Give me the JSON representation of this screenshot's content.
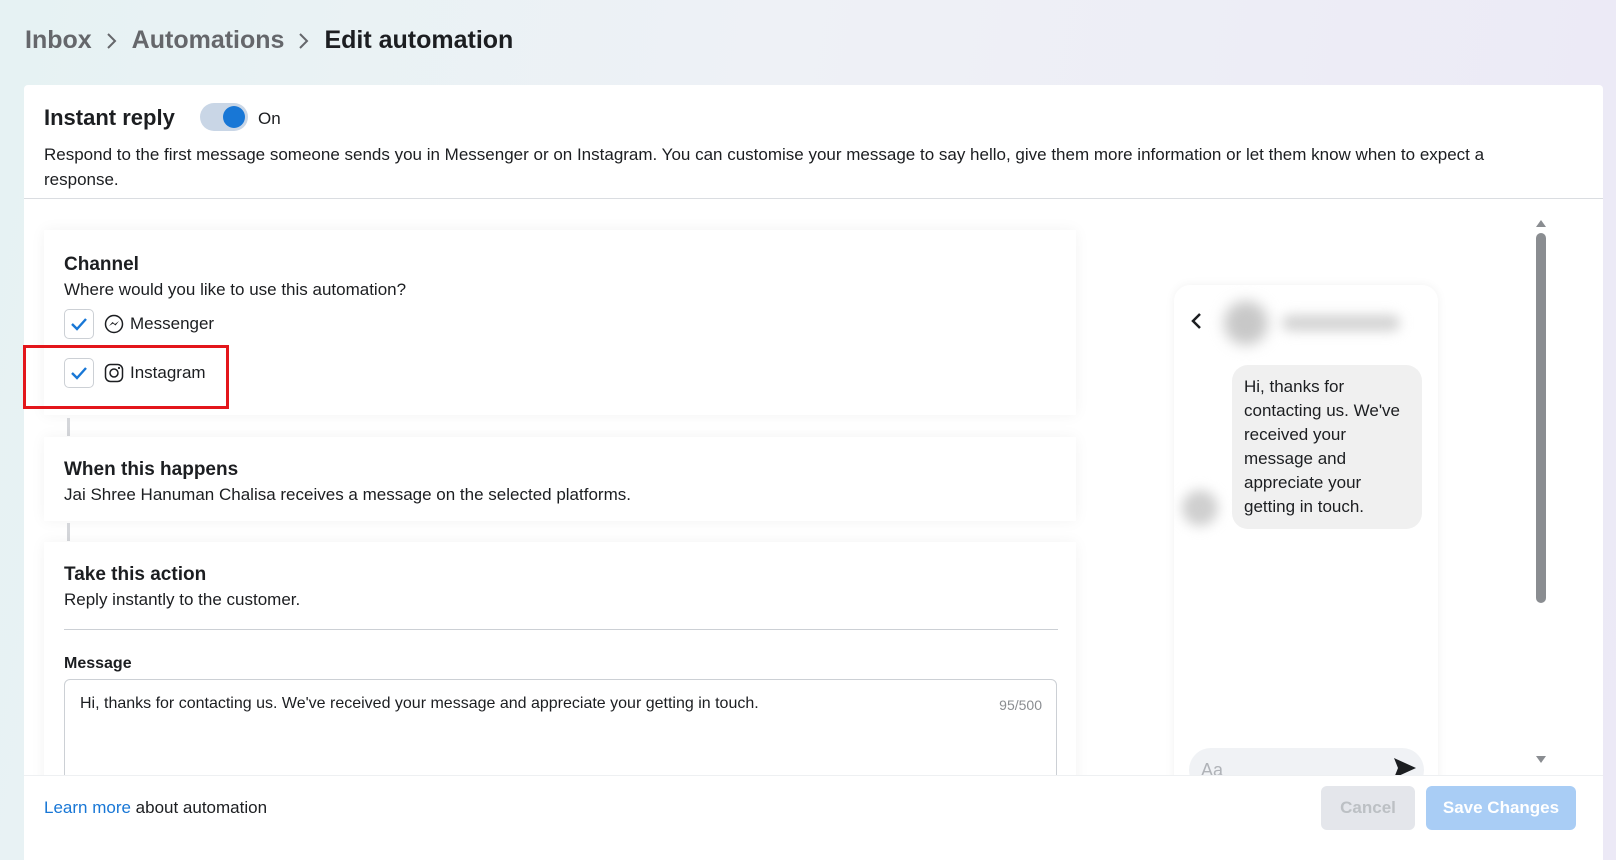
{
  "breadcrumb": {
    "items": [
      "Inbox",
      "Automations",
      "Edit automation"
    ]
  },
  "header": {
    "title": "Instant reply",
    "toggle_state": "On",
    "description": "Respond to the first message someone sends you in Messenger or on Instagram. You can customise your message to say hello, give them more information or let them know when to expect a response."
  },
  "channel": {
    "title": "Channel",
    "subtitle": "Where would you like to use this automation?",
    "options": [
      {
        "label": "Messenger",
        "checked": true,
        "icon": "messenger-icon"
      },
      {
        "label": "Instagram",
        "checked": true,
        "icon": "instagram-icon"
      }
    ]
  },
  "trigger": {
    "title": "When this happens",
    "subtitle": "Jai Shree Hanuman Chalisa receives a message on the selected platforms."
  },
  "action": {
    "title": "Take this action",
    "subtitle": "Reply instantly to the customer.",
    "message_label": "Message",
    "message_text": "Hi, thanks for contacting us. We've received your message and appreciate your getting in touch.",
    "counter": "95/500"
  },
  "preview": {
    "bubble_text": "Hi, thanks for contacting us. We've received your message and appreciate your getting in touch.",
    "compose_placeholder": "Aa"
  },
  "footer": {
    "learn_link": "Learn more",
    "learn_text": " about automation",
    "cancel_label": "Cancel",
    "save_label": "Save Changes"
  },
  "colors": {
    "accent": "#1877d6",
    "highlight": "#e3161b",
    "save_disabled": "#a9cdf5"
  }
}
